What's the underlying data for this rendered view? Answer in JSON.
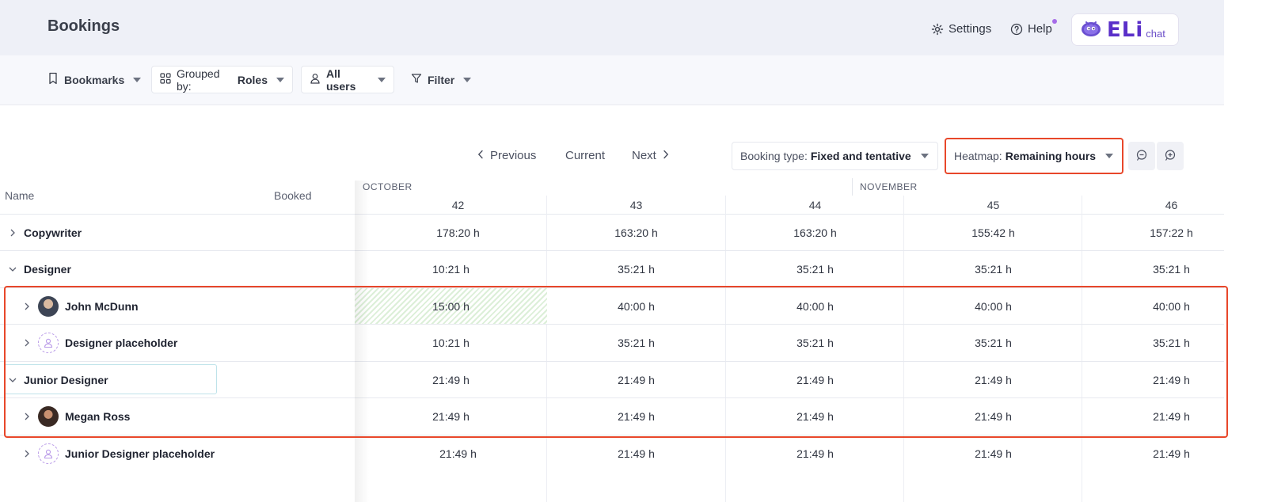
{
  "header": {
    "title": "Bookings",
    "settings_label": "Settings",
    "help_label": "Help",
    "eli_logo_text": "ELi",
    "eli_chat_text": "chat",
    "colors": {
      "accent": "#5a2fc9",
      "highlight": "#e8472a",
      "help_dot": "#a66ce8"
    }
  },
  "filters": {
    "bookmarks_label": "Bookmarks",
    "grouped_prefix": "Grouped by:",
    "grouped_value": "Roles",
    "users_value": "All users",
    "filter_label": "Filter"
  },
  "nav": {
    "previous_label": "Previous",
    "current_label": "Current",
    "next_label": "Next",
    "booking_type_prefix": "Booking type:",
    "booking_type_value": "Fixed and tentative",
    "heatmap_prefix": "Heatmap:",
    "heatmap_value": "Remaining hours"
  },
  "table": {
    "col_name": "Name",
    "col_booked": "Booked",
    "months": [
      "OCTOBER",
      "NOVEMBER"
    ],
    "weeks": [
      "42",
      "43",
      "44",
      "45",
      "46"
    ],
    "rows": [
      {
        "label": "Copywriter",
        "expanded": false,
        "cells": [
          "178:20 h",
          "163:20 h",
          "163:20 h",
          "155:42 h",
          "157:22 h"
        ]
      },
      {
        "label": "Designer",
        "expanded": true,
        "cells": [
          "10:21 h",
          "35:21 h",
          "35:21 h",
          "35:21 h",
          "35:21 h"
        ]
      },
      {
        "label": "John McDunn",
        "avatar": "photo",
        "cells": [
          "15:00 h",
          "40:00 h",
          "40:00 h",
          "40:00 h",
          "40:00 h"
        ]
      },
      {
        "label": "Designer placeholder",
        "avatar": "placeholder",
        "cells": [
          "10:21 h",
          "35:21 h",
          "35:21 h",
          "35:21 h",
          "35:21 h"
        ]
      },
      {
        "label": "Junior Designer",
        "expanded": true,
        "cells": [
          "21:49 h",
          "21:49 h",
          "21:49 h",
          "21:49 h",
          "21:49 h"
        ]
      },
      {
        "label": "Megan Ross",
        "avatar": "photo",
        "cells": [
          "21:49 h",
          "21:49 h",
          "21:49 h",
          "21:49 h",
          "21:49 h"
        ]
      },
      {
        "label": "Junior Designer placeholder",
        "avatar": "placeholder",
        "cells": [
          "21:49 h",
          "21:49 h",
          "21:49 h",
          "21:49 h",
          "21:49 h"
        ]
      }
    ]
  }
}
